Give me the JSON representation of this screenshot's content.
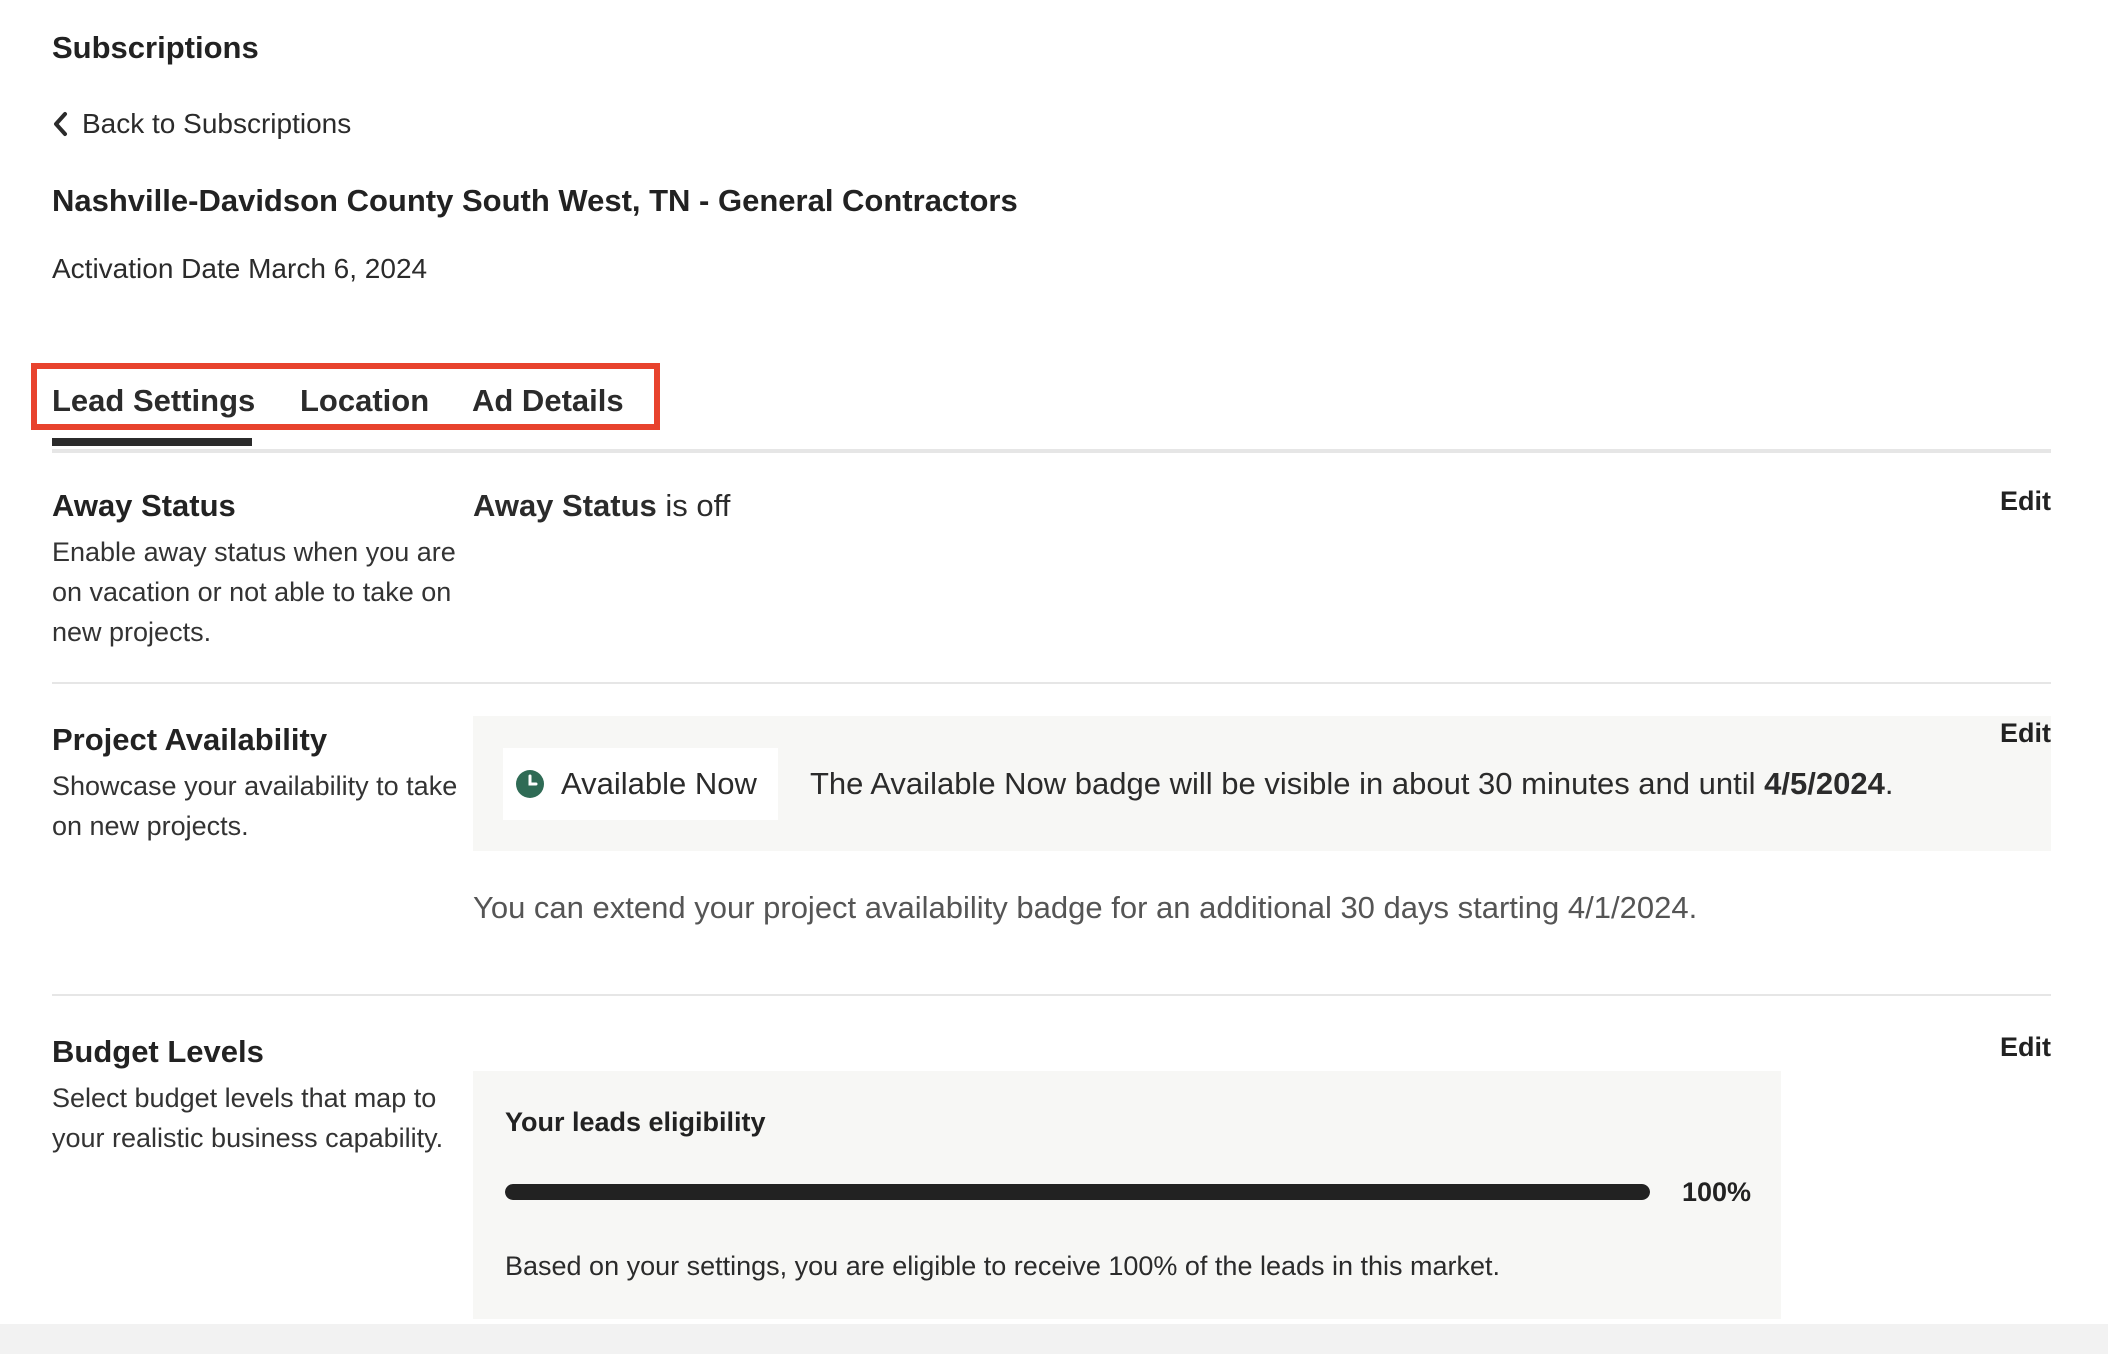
{
  "header": {
    "section_title": "Subscriptions",
    "back_label": "Back to Subscriptions",
    "subscription_title": "Nashville-Davidson County South West, TN - General Contractors",
    "activation_label": "Activation Date March 6, 2024"
  },
  "tabs": [
    {
      "label": "Lead Settings",
      "active": true
    },
    {
      "label": "Location",
      "active": false
    },
    {
      "label": "Ad Details",
      "active": false
    }
  ],
  "away_status": {
    "heading": "Away Status",
    "description": "Enable away status when you are on vacation or not able to take on new projects.",
    "value_strong": "Away Status",
    "value_rest": " is off",
    "edit_label": "Edit"
  },
  "project_availability": {
    "heading": "Project Availability",
    "description": "Showcase your availability to take on new projects.",
    "badge_label": "Available Now",
    "info_text": "The Available Now badge will be visible in about 30 minutes and until ",
    "info_date": "4/5/2024",
    "info_end": ".",
    "extend_text": "You can extend your project availability badge for an additional 30 days starting 4/1/2024.",
    "edit_label": "Edit",
    "badge_icon": "clock-icon",
    "badge_color": "#2f6b55"
  },
  "budget_levels": {
    "heading": "Budget Levels",
    "description": "Select budget levels that map to your realistic business capability.",
    "eligibility_title": "Your leads eligibility",
    "eligibility_percent": 100,
    "eligibility_label": "100%",
    "eligibility_desc": "Based on your settings, you are eligible to receive 100% of the leads in this market.",
    "edit_label": "Edit"
  },
  "colors": {
    "highlight": "#e8432d",
    "text": "#2b2b2b",
    "panel": "#f7f7f5"
  }
}
